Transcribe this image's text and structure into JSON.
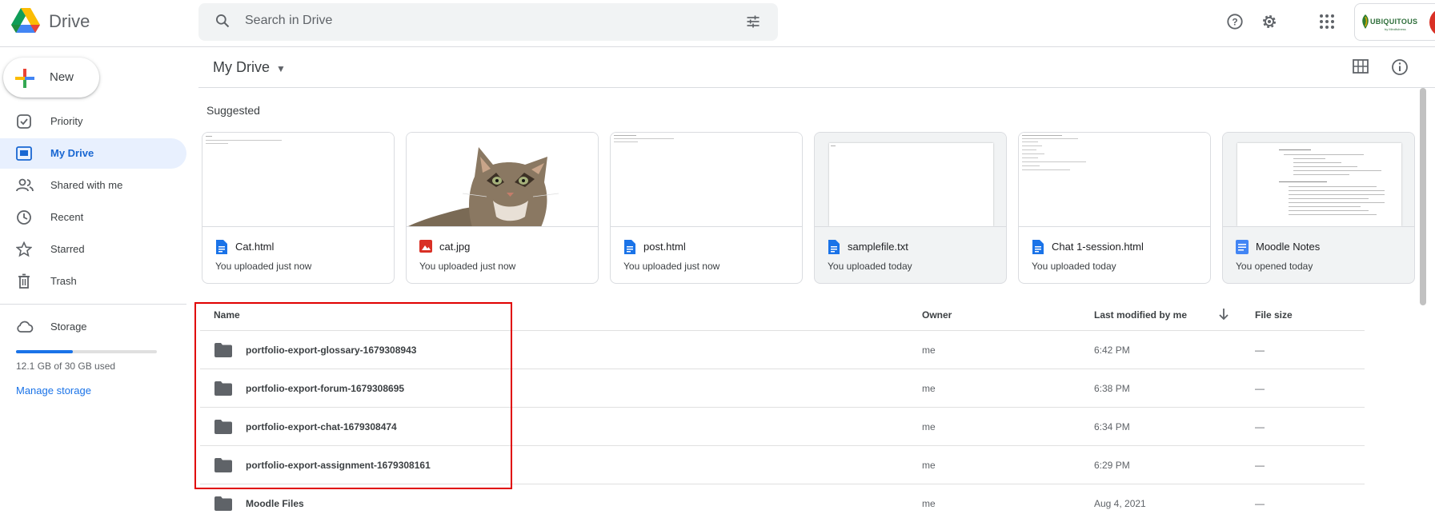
{
  "header": {
    "app_name": "Drive",
    "search_placeholder": "Search in Drive",
    "account_logo_text": "UBIQUITOUS",
    "account_logo_sub": "by Mindfulness",
    "icons": [
      "drive-logo-icon",
      "search-icon",
      "tune-icon",
      "help-icon",
      "gear-icon",
      "apps-icon"
    ]
  },
  "sidebar": {
    "new_label": "New",
    "items": [
      {
        "label": "Priority",
        "icon": "priority-icon",
        "active": false
      },
      {
        "label": "My Drive",
        "icon": "my-drive-icon",
        "active": true
      },
      {
        "label": "Shared with me",
        "icon": "shared-icon",
        "active": false
      },
      {
        "label": "Recent",
        "icon": "clock-icon",
        "active": false
      },
      {
        "label": "Starred",
        "icon": "star-icon",
        "active": false
      },
      {
        "label": "Trash",
        "icon": "trash-icon",
        "active": false
      }
    ],
    "storage": {
      "label": "Storage",
      "used_text": "12.1 GB of 30 GB used",
      "used_fraction": 0.403,
      "manage_label": "Manage storage"
    }
  },
  "main": {
    "breadcrumb": "My Drive",
    "suggested_heading": "Suggested",
    "suggested": [
      {
        "name": "Cat.html",
        "meta": "You uploaded just now",
        "icon": "doc-icon"
      },
      {
        "name": "cat.jpg",
        "meta": "You uploaded just now",
        "icon": "image-icon"
      },
      {
        "name": "post.html",
        "meta": "You uploaded just now",
        "icon": "doc-icon"
      },
      {
        "name": "samplefile.txt",
        "meta": "You uploaded today",
        "icon": "doc-icon"
      },
      {
        "name": "Chat 1-session.html",
        "meta": "You uploaded today",
        "icon": "doc-icon"
      },
      {
        "name": "Moodle Notes",
        "meta": "You opened today",
        "icon": "docs-icon"
      }
    ],
    "table": {
      "columns": {
        "name": "Name",
        "owner": "Owner",
        "modified": "Last modified by me",
        "size": "File size"
      },
      "rows": [
        {
          "name": "portfolio-export-glossary-1679308943",
          "owner": "me",
          "modified": "6:42 PM",
          "size": "—"
        },
        {
          "name": "portfolio-export-forum-1679308695",
          "owner": "me",
          "modified": "6:38 PM",
          "size": "—"
        },
        {
          "name": "portfolio-export-chat-1679308474",
          "owner": "me",
          "modified": "6:34 PM",
          "size": "—"
        },
        {
          "name": "portfolio-export-assignment-1679308161",
          "owner": "me",
          "modified": "6:29 PM",
          "size": "—"
        },
        {
          "name": "Moodle Files",
          "owner": "me",
          "modified": "Aug 4, 2021",
          "size": "—"
        }
      ]
    }
  },
  "colors": {
    "accent": "#1a73e8",
    "active_bg": "#e8f0fe",
    "highlight": "#e00000"
  }
}
